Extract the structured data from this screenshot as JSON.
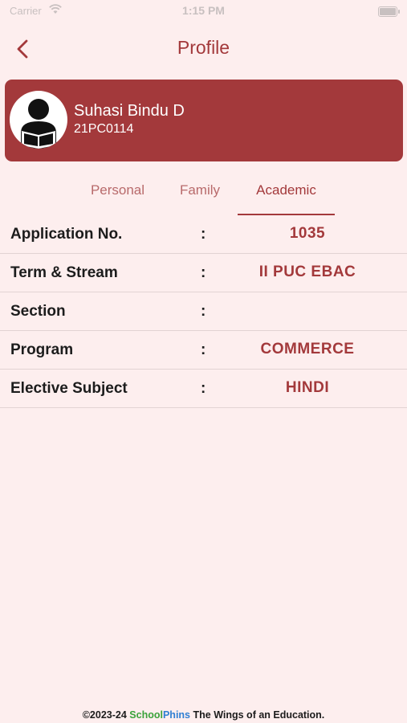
{
  "status_bar": {
    "carrier": "Carrier",
    "time": "1:15 PM"
  },
  "header": {
    "title": "Profile"
  },
  "profile": {
    "name": "Suhasi Bindu D",
    "id": "21PC0114"
  },
  "tabs": [
    {
      "label": "Personal",
      "active": false
    },
    {
      "label": "Family",
      "active": false
    },
    {
      "label": "Academic",
      "active": true
    }
  ],
  "academic_rows": [
    {
      "label": "Application No.",
      "colon": ":",
      "value": "1035"
    },
    {
      "label": "Term & Stream",
      "colon": ":",
      "value": "II PUC EBAC"
    },
    {
      "label": "Section",
      "colon": ":",
      "value": ""
    },
    {
      "label": "Program",
      "colon": ":",
      "value": "COMMERCE"
    },
    {
      "label": "Elective Subject",
      "colon": ":",
      "value": "HINDI"
    }
  ],
  "footer": {
    "copyright": "©2023-24",
    "brand_part1": "School",
    "brand_part2": "Phins",
    "tagline": "The Wings of an Education."
  },
  "colors": {
    "accent": "#a3393b",
    "background": "#fdeeee",
    "brand_green": "#3aa23a",
    "brand_blue": "#2f7fd3"
  }
}
